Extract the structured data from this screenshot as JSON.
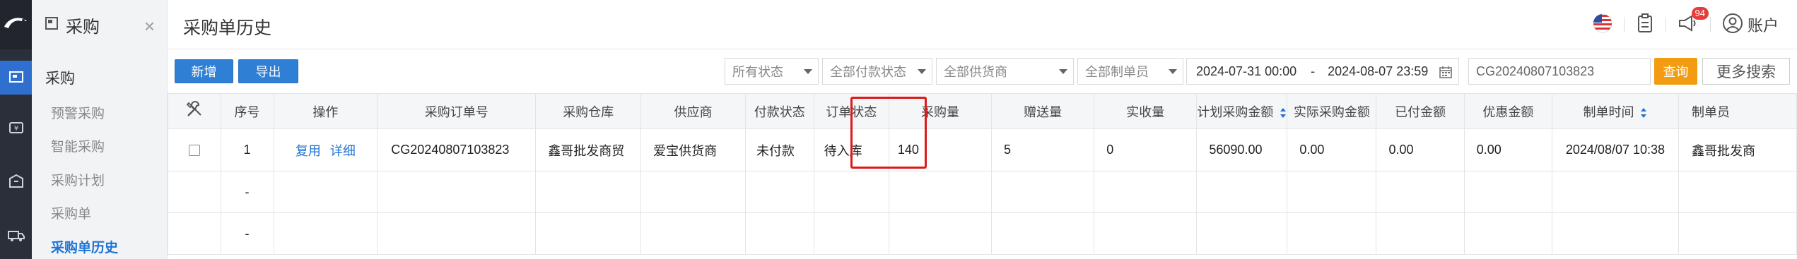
{
  "sidebar": {
    "title": "采购",
    "close": "×",
    "group": "采购",
    "items": [
      {
        "label": "预警采购"
      },
      {
        "label": "智能采购"
      },
      {
        "label": "采购计划"
      },
      {
        "label": "采购单"
      },
      {
        "label": "采购单历史"
      }
    ]
  },
  "header": {
    "page_title": "采购单历史",
    "notification_count": "94",
    "account_label": "账户"
  },
  "toolbar": {
    "new_label": "新增",
    "export_label": "导出",
    "status_filter": "所有状态",
    "payment_filter": "全部付款状态",
    "supplier_filter": "全部供货商",
    "creator_filter": "全部制单员",
    "date_start": "2024-07-31 00:00",
    "date_sep": "-",
    "date_end": "2024-08-07 23:59",
    "search_value": "CG20240807103823",
    "query_label": "查询",
    "more_search_label": "更多搜索"
  },
  "table": {
    "headers": {
      "seq": "序号",
      "op": "操作",
      "order_no": "采购订单号",
      "warehouse": "采购仓库",
      "supplier": "供应商",
      "pay_status": "付款状态",
      "order_status": "订单状态",
      "qty": "采购量",
      "gift_qty": "赠送量",
      "received": "实收量",
      "planned_amount": "计划采购金额",
      "actual_amount": "实际采购金额",
      "paid_amount": "已付金额",
      "discount": "优惠金额",
      "created_time": "制单时间",
      "creator": "制单员"
    },
    "rows": [
      {
        "seq": "1",
        "op_reuse": "复用",
        "op_detail": "详细",
        "order_no": "CG20240807103823",
        "warehouse": "鑫哥批发商贸",
        "supplier": "爱宝供货商",
        "pay_status": "未付款",
        "order_status": "待入库",
        "qty": "140",
        "gift_qty": "5",
        "received": "0",
        "planned_amount": "56090.00",
        "actual_amount": "0.00",
        "paid_amount": "0.00",
        "discount": "0.00",
        "created_time": "2024/08/07 10:38",
        "creator": "鑫哥批发商"
      }
    ],
    "summary_rows": [
      {
        "seq": "-"
      },
      {
        "seq": "-"
      }
    ]
  },
  "colors": {
    "primary": "#2f7fd5",
    "accent_orange": "#f39c12",
    "highlight": "#e01818",
    "rail_bg": "#2b2f3a",
    "rail_active": "#2f6fcf",
    "badge": "#e73c3c"
  }
}
